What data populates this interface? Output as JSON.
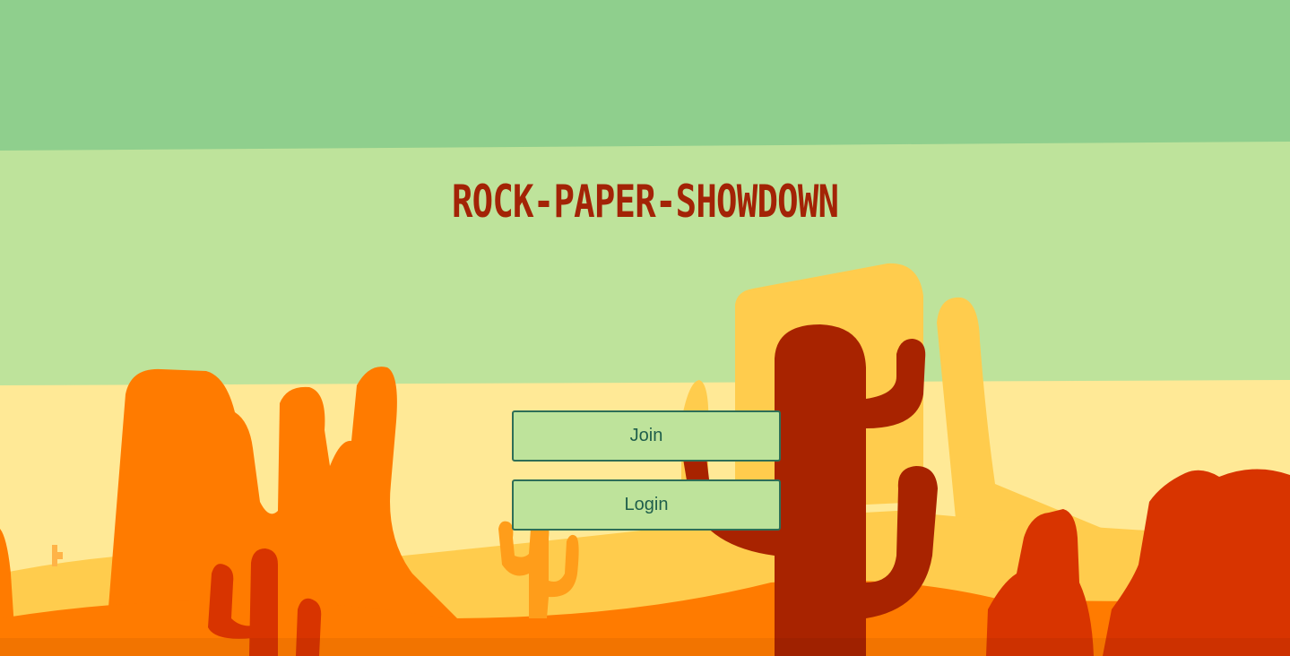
{
  "page": {
    "title": "ROCK-PAPER-SHOWDOWN"
  },
  "menu": {
    "join_label": "Join",
    "login_label": "Login"
  },
  "colors": {
    "sky_top": "#8fcf8d",
    "sky_band": "#bee39b",
    "horizon": "#ffe996",
    "title": "#a32306",
    "button_bg": "#bee39b",
    "button_border": "#2e6e57",
    "button_text": "#1f5e4b"
  },
  "background": {
    "description_icon": "desert-landscape-icon"
  }
}
